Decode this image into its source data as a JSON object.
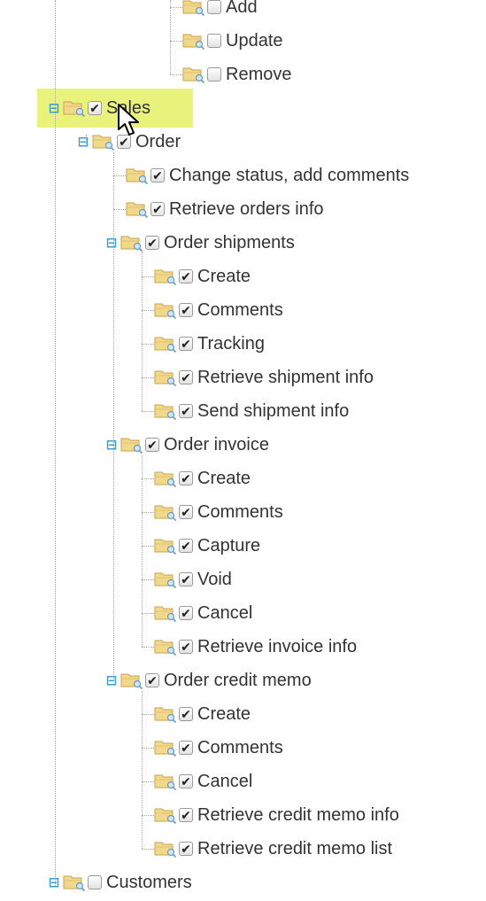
{
  "tree": {
    "top_items": [
      {
        "label": "Add",
        "checked": false
      },
      {
        "label": "Update",
        "checked": false
      },
      {
        "label": "Remove",
        "checked": false
      }
    ],
    "sales": {
      "label": "Sales",
      "checked": true,
      "order": {
        "label": "Order",
        "checked": true,
        "change_status": "Change status, add comments",
        "retrieve_orders": "Retrieve orders info",
        "shipments": {
          "label": "Order shipments",
          "items": [
            "Create",
            "Comments",
            "Tracking",
            "Retrieve shipment info",
            "Send shipment info"
          ]
        },
        "invoice": {
          "label": "Order invoice",
          "items": [
            "Create",
            "Comments",
            "Capture",
            "Void",
            "Cancel",
            "Retrieve invoice info"
          ]
        },
        "credit_memo": {
          "label": "Order credit memo",
          "items": [
            "Create",
            "Comments",
            "Cancel",
            "Retrieve credit memo info",
            "Retrieve credit memo list"
          ]
        }
      }
    },
    "customers": {
      "label": "Customers",
      "checked": false
    }
  },
  "icons": {
    "expanded": "minus-box-icon",
    "folder": "folder-icon",
    "checked": "checkmark-icon"
  },
  "colors": {
    "highlight": "#e9f27a",
    "toggle": "#3a9fd0",
    "folder_fill": "#f2d88a"
  }
}
